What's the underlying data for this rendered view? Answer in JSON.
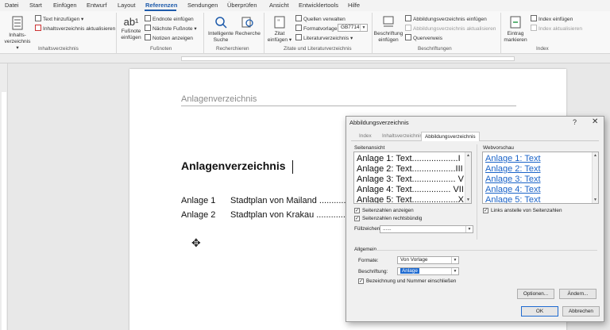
{
  "menubar": {
    "tabs": [
      "Datei",
      "Start",
      "Einfügen",
      "Entwurf",
      "Layout",
      "Referenzen",
      "Sendungen",
      "Überprüfen",
      "Ansicht",
      "Entwicklertools",
      "Hilfe"
    ],
    "active_tab": "Referenzen"
  },
  "ribbon": {
    "toc": {
      "large_button": [
        "Inhalts-",
        "verzeichnis ▾"
      ],
      "add_text": "Text hinzufügen ▾",
      "update": "Inhaltsverzeichnis aktualisieren",
      "group": "Inhaltsverzeichnis"
    },
    "footnotes": {
      "large_button": [
        "Fußnote",
        "einfügen"
      ],
      "large_icon": "ab¹",
      "endnote": "Endnote einfügen",
      "next": "Nächste Fußnote ▾",
      "show": "Notizen anzeigen",
      "group": "Fußnoten"
    },
    "research": {
      "smart": [
        "Intelligente",
        "Suche"
      ],
      "research": "Recherche",
      "group": "Recherchieren"
    },
    "citations": {
      "insert": [
        "Zitat",
        "einfügen ▾"
      ],
      "manage": "Quellen verwalten",
      "style_label": "Formatvorlage:",
      "style_value": "GB7714",
      "bibliography": "Literaturverzeichnis ▾",
      "group": "Zitate und Literaturverzeichnis"
    },
    "captions": {
      "insert": [
        "Beschriftung",
        "einfügen"
      ],
      "insert_tof": "Abbildungsverzeichnis einfügen",
      "update_table": "Abbildungsverzeichnis aktualisieren",
      "cross_ref": "Querverweis",
      "group": "Beschriftungen"
    },
    "index": {
      "mark": [
        "Eintrag",
        "markieren"
      ],
      "insert": "Index einfügen",
      "update": "Index aktualisieren",
      "group": "Index"
    }
  },
  "document": {
    "header_text": "Anlagenverzeichnis",
    "heading": "Anlagenverzeichnis",
    "entries": [
      {
        "label": "Anlage 1",
        "text": "Stadtplan von Mailand ..............."
      },
      {
        "label": "Anlage 2",
        "text": "Stadtplan von Krakau ................"
      }
    ]
  },
  "dialog": {
    "title": "Abbildungsverzeichnis",
    "help": "?",
    "close": "✕",
    "tabs": [
      "Index",
      "Inhaltsverzeichnis",
      "Abbildungsverzeichnis"
    ],
    "active_tab": "Abbildungsverzeichnis",
    "print_preview_label": "Seitenansicht",
    "print_preview": [
      "Anlage 1: Text...................I",
      "Anlage 2: Text..................III",
      "Anlage 3: Text.................. V",
      "Anlage 4: Text................ VII",
      "Anlage 5: Text...................X"
    ],
    "web_preview_label": "Webvorschau",
    "web_preview": [
      "Anlage 1: Text",
      "Anlage 2: Text",
      "Anlage 3: Text",
      "Anlage 4: Text",
      "Anlage 5: Text"
    ],
    "show_page_numbers": "Seitenzahlen anzeigen",
    "right_align": "Seitenzahlen rechtsbündig",
    "tab_leader_label": "Füllzeichen:",
    "tab_leader_value": "......",
    "use_hyperlinks": "Links anstelle von Seitenzahlen",
    "general_label": "Allgemein",
    "formats_label": "Formate:",
    "formats_value": "Von Vorlage",
    "caption_label": "Beschriftung:",
    "caption_value": "Anlage",
    "include_label": "Bezeichnung und Nummer einschließen",
    "options_button": "Optionen...",
    "modify_button": "Ändern...",
    "ok_button": "OK",
    "cancel_button": "Abbrechen"
  },
  "colors": {
    "accent": "#1e5bab",
    "link": "#1a63c8",
    "selection": "#1e6ad0"
  }
}
